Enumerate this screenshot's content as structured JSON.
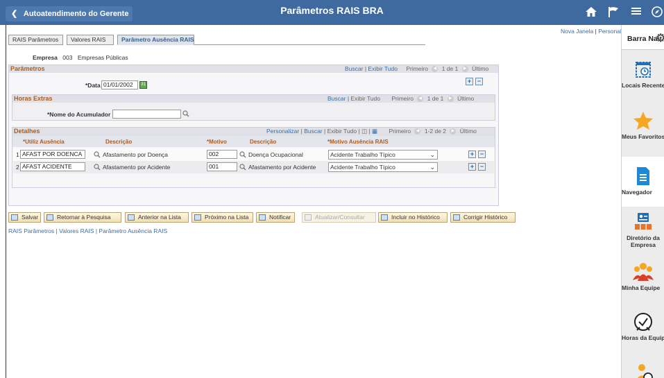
{
  "header": {
    "back_label": "Autoatendimento do Gerente",
    "title": "Parâmetros RAIS BRA",
    "icons": [
      "home-icon",
      "flag-icon",
      "menu-icon",
      "compass-icon"
    ]
  },
  "toplinks": {
    "new_window": "Nova Janela",
    "personalize": "Personalizar Página"
  },
  "nav_bar": {
    "title": "Barra Nav",
    "tiles": [
      {
        "label": "Locais Recentes",
        "icon": "recent-calendar-icon"
      },
      {
        "label": "Meus Favoritos",
        "icon": "star-icon"
      },
      {
        "label": "Navegador",
        "icon": "document-icon"
      },
      {
        "label": "Diretório da Empresa",
        "icon": "directory-icon"
      },
      {
        "label": "Minha Equipe",
        "icon": "team-icon"
      },
      {
        "label": "Horas da Equipe",
        "icon": "clock-icon"
      },
      {
        "label": "",
        "icon": "person-clock-icon"
      }
    ]
  },
  "tabs": [
    "RAIS Parâmetros",
    "Valores RAIS",
    "Parâmetro Ausência RAIS"
  ],
  "empresa": {
    "label": "Empresa",
    "code": "003",
    "name": "Empresas Públicas"
  },
  "parametros": {
    "title": "Parâmetros",
    "search": "Buscar",
    "show_all": "Exibir Tudo",
    "first": "Primeiro",
    "counter": "1 de 1",
    "last": "Último",
    "date_label": "*Data Efetiva",
    "date_value": "01/01/2002"
  },
  "horas_extras": {
    "title": "Horas Extras",
    "search": "Buscar",
    "show_all": "Exibir Tudo",
    "first": "Primeiro",
    "counter": "1 de 1",
    "last": "Último",
    "acumulador_label": "*Nome do Acumulador",
    "acumulador_value": ""
  },
  "detalhes": {
    "title": "Detalhes",
    "personalize": "Personalizar",
    "search": "Buscar",
    "show_all": "Exibir Tudo",
    "first": "Primeiro",
    "counter": "1-2 de 2",
    "last": "Último",
    "columns": [
      "*Utiliz Ausência",
      "Descrição",
      "*Motivo",
      "Descrição",
      "*Motivo Ausência RAIS"
    ],
    "rows": [
      {
        "num": "1",
        "ausencia": "AFAST POR DOENCA",
        "desc1": "Afastamento por Doença",
        "motivo": "002",
        "desc2": "Doença Ocupacional",
        "rais": "Acidente Trabalho Típico"
      },
      {
        "num": "2",
        "ausencia": "AFAST ACIDENTE",
        "desc1": "Afastamento por Acidente",
        "motivo": "001",
        "desc2": "Afastamento por Acidente",
        "rais": "Acidente Trabalho Típico"
      }
    ]
  },
  "toolbar": {
    "save": "Salvar",
    "return": "Retornar à Pesquisa",
    "previous": "Anterior na Lista",
    "next": "Próximo na Lista",
    "notify": "Notificar",
    "update": "Atualizar/Consultar",
    "include_history": "Incluir no Histórico",
    "correct_history": "Corrigir Histórico"
  },
  "footlinks": {
    "link1": "RAIS Parâmetros",
    "link2": "Valores RAIS",
    "link3": "Parâmetro Ausência RAIS"
  }
}
